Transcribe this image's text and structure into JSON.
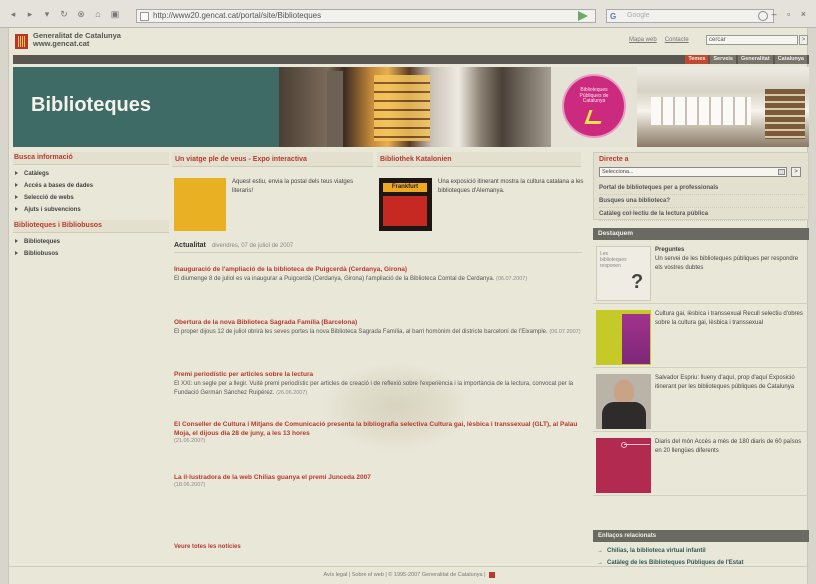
{
  "browser": {
    "url": "http://www20.gencat.cat/portal/site/Biblioteques",
    "search_placeholder": "Google"
  },
  "header": {
    "org_name": "Generalitat de Catalunya",
    "org_site": "www.gencat.cat",
    "links": [
      "Mapa web",
      "Contacte"
    ],
    "search_value": "cercar",
    "search_button": ">",
    "nav_tabs": [
      "Temes",
      "Serveis",
      "Generalitat",
      "Catalunya"
    ]
  },
  "banner": {
    "title": "Biblioteques",
    "circle_text": "Biblioteques Públiques de Catalunya"
  },
  "left": {
    "section1_title": "Busca informació",
    "section1_items": [
      "Catàlegs",
      "Accés a bases de dades",
      "Selecció de webs",
      "Ajuts i subvencions"
    ],
    "section2_title": "Biblioteques i Bibliobusos",
    "section2_items": [
      "Biblioteques",
      "Bibliobusos"
    ]
  },
  "features": [
    {
      "title": "Un viatge ple de veus - Expo interactiva",
      "text": "Aquest estiu, envia la postal dels teus viatges literaris!"
    },
    {
      "title": "Bibliothek Katalonien",
      "image_label": "Frankfurt",
      "text": "Una exposició itinerant mostra la cultura catalana a les biblioteques d'Alemanya."
    }
  ],
  "actualitat": {
    "label": "Actualitat",
    "date": "divendres, 07 de juliol de 2007"
  },
  "news": [
    {
      "title": "Inauguració de l'ampliació de la biblioteca de Puigcerdà (Cerdanya, Girona)",
      "desc": "El diumenge 8 de juliol es va inaugurar a Puigcerdà (Cerdanya, Girona) l'ampliació de la Biblioteca Comtal de Cerdanya.",
      "date": "(06.07.2007)"
    },
    {
      "title": "Obertura de la nova Biblioteca Sagrada Família (Barcelona)",
      "desc": "El proper dijous 12 de juliol obrirà les seves portes la nova Biblioteca Sagrada Família, al barri homònim del districte barceloní de l'Eixample.",
      "date": "(06.07.2007)"
    },
    {
      "title": "Premi periodístic per articles sobre la lectura",
      "desc": "El XXI: un segle per a llegir. Vuitè premi periodístic per articles de creació i de reflexió sobre l'experiència i la importància de la lectura, convocat per la Fundació Germán Sánchez Ruipérez.",
      "date": "(26.06.2007)"
    },
    {
      "title": "El Conseller de Cultura i Mitjans de Comunicació presenta la bibliografia selectiva Cultura gai, lèsbica i transsexual (GLT), al Palau Moja, el dijous dia 28 de juny, a les 13 hores",
      "desc": "",
      "date": "(21.06.2007)"
    },
    {
      "title": "La il·lustradora de la web Chilias guanya el premi Junceda 2007",
      "desc": "",
      "date": "(18.06.2007)"
    }
  ],
  "see_all": "Veure totes les notícies",
  "right": {
    "directe_title": "Directe a",
    "select_value": "Selecciona...",
    "select_button": ">",
    "directe_links": [
      "Portal de biblioteques per a professionals",
      "Busques una biblioteca?",
      "Catàleg col·lectiu de la lectura pública"
    ],
    "destaquem_title": "Destaquem",
    "destaquem": [
      {
        "title": "Preguntes",
        "text": "Un servei de les biblioteques públiques per respondre els vostres dubtes",
        "thumb_label": "Les biblioteques responen"
      },
      {
        "title": "",
        "text": "Cultura gai, lèsbica i transsexual Recull selectiu d'obres sobre la cultura gai, lèsbica i transsexual"
      },
      {
        "title": "",
        "text": "Salvador Espriu: llueny d'aquí, prop d'aquí Exposició itinerant per les biblioteques públiques de Catalunya"
      },
      {
        "title": "",
        "text": "Diaris del món Accés a més de 180 diaris de 60 països en 20 llengües diferents"
      }
    ],
    "related_title": "Enllaços relacionats",
    "related_links": [
      "Chilias, la biblioteca virtual infantil",
      "Catàleg de les Biblioteques Públiques de l'Estat"
    ]
  },
  "footer": {
    "text": "Avís legal | Sobre el web | © 1995-2007 Generalitat de Catalunya |"
  }
}
